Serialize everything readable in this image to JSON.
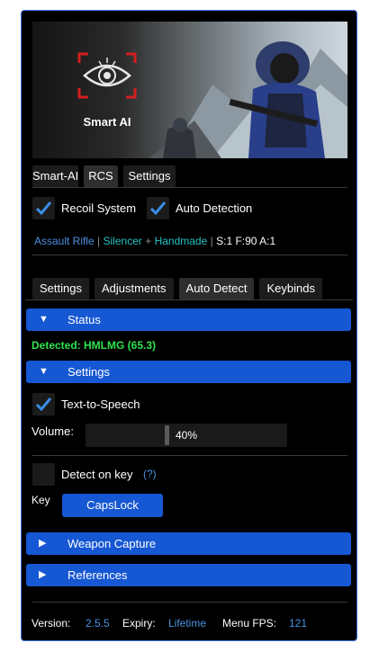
{
  "banner": {
    "logo_text": "Smart AI",
    "accent": "#d21e1e"
  },
  "main_tabs": [
    "Smart-AI",
    "RCS",
    "Settings"
  ],
  "rcs": {
    "recoil_system_label": "Recoil System",
    "auto_detection_label": "Auto Detection",
    "weapon": "Assault Rifle",
    "sep1": "|",
    "attachment1": "Silencer",
    "plus": "+",
    "attachment2": "Handmade",
    "sep2": "|",
    "stats": "S:1 F:90 A:1"
  },
  "sub_tabs": [
    "Settings",
    "Adjustments",
    "Auto Detect",
    "Keybinds"
  ],
  "status": {
    "header": "Status",
    "arrow": "▼",
    "detected": "Detected: HMLMG (65.3)"
  },
  "settings": {
    "header": "Settings",
    "arrow": "▼",
    "tts_label": "Text-to-Speech",
    "tts_checked": true,
    "volume_label": "Volume:",
    "volume_value": "40%",
    "volume_fraction": 0.4,
    "detect_on_key_label": "Detect on key",
    "detect_on_key_checked": false,
    "help": "(?)",
    "key_label": "Key",
    "key_value": "CapsLock"
  },
  "weapon_capture": {
    "header": "Weapon Capture",
    "arrow": "▶"
  },
  "references": {
    "header": "References",
    "arrow": "▶"
  },
  "footer": {
    "version_label": "Version:",
    "version": "2.5.5",
    "expiry_label": "Expiry:",
    "expiry": "Lifetime",
    "fps_label": "Menu FPS:",
    "fps": "121"
  },
  "colors": {
    "accent_blue": "#1657d3",
    "check_blue": "#3a8ee6",
    "detected_green": "#2ee24d"
  }
}
